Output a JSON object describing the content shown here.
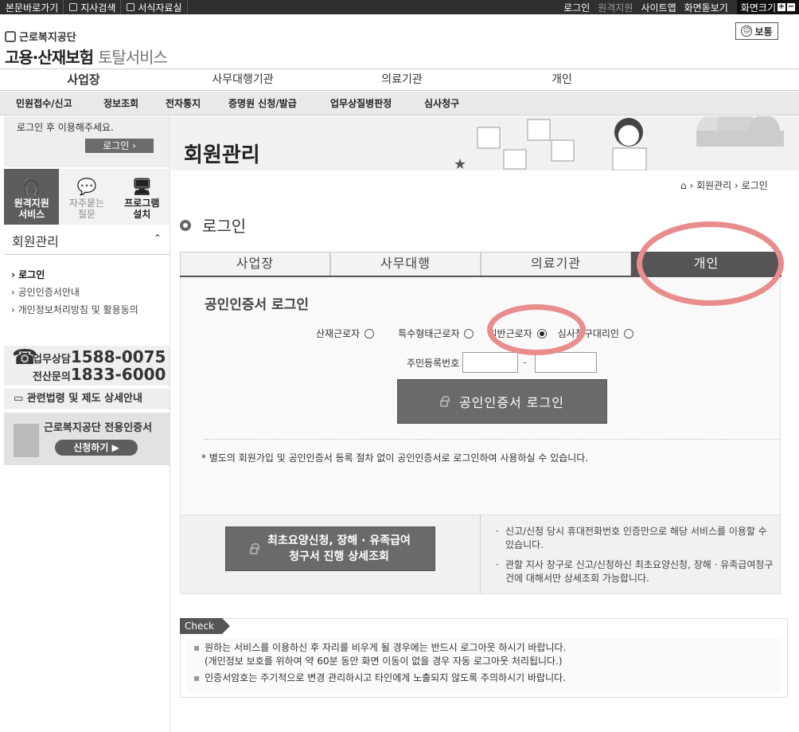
{
  "topbar": {
    "left": [
      "본문바로가기",
      "지사검색",
      "서식자료실"
    ],
    "right": {
      "login": "로그인",
      "remote": "원격지원",
      "sitemap": "사이트맵",
      "print": "화면돋보기",
      "zoom": "화면크기"
    }
  },
  "logo": {
    "org": "근로복지공단",
    "service_main": "고용·산재보험",
    "service_sub": "토탈서비스"
  },
  "mode_button": "보통",
  "main_nav": [
    "사업장",
    "사무대행기관",
    "의료기관",
    "개인"
  ],
  "sub_nav": [
    "민원접수/신고",
    "정보조회",
    "전자통지",
    "증명원 신청/발급",
    "업무상질병판정",
    "심사청구"
  ],
  "sidebar": {
    "login_msg": "로그인 후 이용해주세요.",
    "login_btn": "로그인",
    "quick": [
      {
        "label_1": "원격지원",
        "label_2": "서비스"
      },
      {
        "label_1": "자주묻는",
        "label_2": "질문"
      },
      {
        "label_1": "프로그램",
        "label_2": "설치"
      }
    ],
    "section_title": "회원관리",
    "menu": [
      "로그인",
      "공인인증서안내",
      "개인정보처리방침 및 활용동의"
    ],
    "contact": {
      "l1_label": "업무상담",
      "l1_num": "1588-0075",
      "l2_label": "전산문의",
      "l2_num": "1833-6000"
    },
    "law": "관련법령 및 제도 상세안내",
    "cert_caption": "근로복지공단 전용인증서",
    "cert_apply": "신청하기"
  },
  "banner_title": "회원관리",
  "breadcrumb": {
    "l1": "회원관리",
    "l2": "로그인"
  },
  "page_title": "로그인",
  "tabs": [
    "사업장",
    "사무대행",
    "의료기관",
    "개인"
  ],
  "active_tab": "개인",
  "login": {
    "heading": "공인인증서 로그인",
    "radios": [
      "산재근로자",
      "특수형태근로자",
      "일반근로자",
      "심사청구대리인"
    ],
    "selected_radio": "일반근로자",
    "ssn_label": "주민등록번호",
    "ssn_dash": "-",
    "cert_button": "공인인증서 로그인",
    "note": "별도의 회원가입 및 공인인증서 등록 절차 없이 공인인증서로 로그인하여 사용하실 수 있습니다."
  },
  "mobile": {
    "button_l1": "최초요양신청, 장해 · 유족급여",
    "button_l2": "청구서 진행 상세조회",
    "tip1": "신고/신청 당시 휴대전화번호 인증만으로 해당 서비스를 이용할 수 있습니다.",
    "tip2": "관할 지사 창구로 신고/신청하신 최초요양신청, 장해 · 유족급여청구건에 대해서만 상세조회 가능합니다."
  },
  "check": {
    "tag": "Check",
    "line1": "원하는 서비스를 이용하신 후 자리를 비우게 될 경우에는 반드시 로그아웃 하시기 바랍니다.",
    "line1b": "(개인정보 보호를 위하여 약 60분 동안 화면 이동이 없을 경우 자동 로그아웃 처리됩니다.)",
    "line2": "인증서암호는 주기적으로 변경 관리하시고 타인에게 노출되지 않도록 주의하시기 바랍니다."
  }
}
